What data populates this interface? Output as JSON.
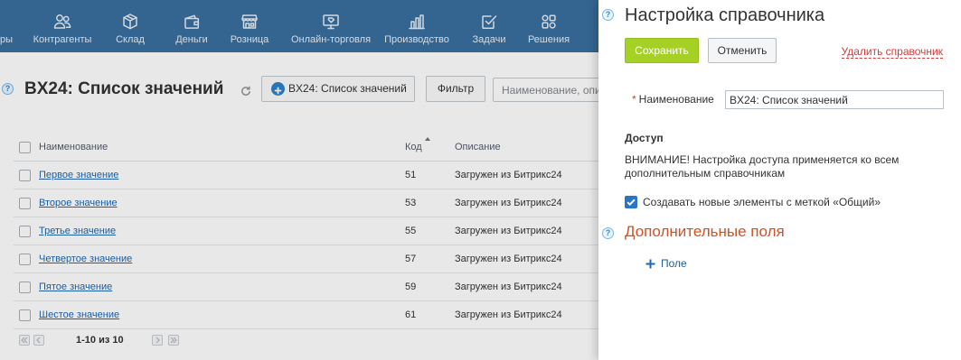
{
  "colors": {
    "nav_background": "#3a70a0",
    "link": "#2067b0",
    "save_button": "#a5d024",
    "delete_link": "#d23b38",
    "section_heading": "#d3501f",
    "checkbox_checked": "#2a74c5"
  },
  "nav": {
    "items": [
      {
        "label": "ры"
      },
      {
        "label": "Контрагенты",
        "icon": "contacts-icon"
      },
      {
        "label": "Склад",
        "icon": "warehouse-icon"
      },
      {
        "label": "Деньги",
        "icon": "wallet-icon"
      },
      {
        "label": "Розница",
        "icon": "store-icon"
      },
      {
        "label": "Онлайн-торговля",
        "icon": "online-store-icon"
      },
      {
        "label": "Производство",
        "icon": "production-icon"
      },
      {
        "label": "Задачи",
        "icon": "tasks-icon"
      },
      {
        "label": "Решения",
        "icon": "solutions-icon"
      }
    ]
  },
  "list_page": {
    "title": "BX24: Список значений",
    "add_button": "BX24: Список значений",
    "filter_button": "Фильтр",
    "search_placeholder": "Наименование, опи",
    "columns": {
      "name": "Наименование",
      "code": "Код",
      "description": "Описание"
    },
    "sort": {
      "column": "code",
      "icon": "sort-asc-icon"
    },
    "rows": [
      {
        "name": "Первое значение",
        "code": "51",
        "description": "Загружен из Битрикс24"
      },
      {
        "name": "Второе значение",
        "code": "53",
        "description": "Загружен из Битрикс24"
      },
      {
        "name": "Третье значение",
        "code": "55",
        "description": "Загружен из Битрикс24"
      },
      {
        "name": "Четвертое значение",
        "code": "57",
        "description": "Загружен из Битрикс24"
      },
      {
        "name": "Пятое значение",
        "code": "59",
        "description": "Загружен из Битрикс24"
      },
      {
        "name": "Шестое значение",
        "code": "61",
        "description": "Загружен из Битрикс24"
      }
    ],
    "pagination": {
      "range": "1-10 из 10"
    }
  },
  "settings_panel": {
    "title": "Настройка справочника",
    "save_button": "Сохранить",
    "cancel_button": "Отменить",
    "delete_link": "Удалить справочник",
    "name_field": {
      "required_mark": "*",
      "label": "Наименование",
      "value": "BX24: Список значений"
    },
    "access": {
      "heading": "Доступ",
      "note": "ВНИМАНИЕ! Настройка доступа применяется ко всем дополнительным справочникам",
      "shared_checkbox": {
        "label": "Создавать новые элементы с меткой «Общий»",
        "checked": true
      }
    },
    "extra_fields": {
      "heading": "Дополнительные поля",
      "add_field": "Поле"
    }
  }
}
